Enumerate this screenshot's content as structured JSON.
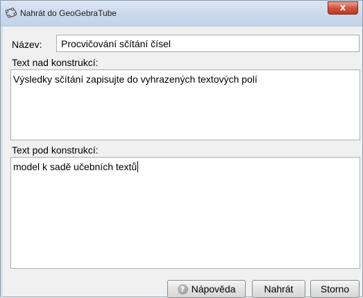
{
  "window": {
    "title": "Nahrát do GeoGebraTube",
    "close_symbol": "x"
  },
  "form": {
    "name_label": "Název:",
    "name_value": "Procvičování sčítání čísel",
    "text_above_label": "Text nad konstrukcí:",
    "text_above_value": "Výsledky sčítání zapisujte do vyhrazených textových polí",
    "text_below_label": "Text pod konstrukcí:",
    "text_below_value": "model k sadě učebních textů"
  },
  "buttons": {
    "help_label": "Nápověda",
    "help_icon_glyph": "?",
    "upload_label": "Nahrát",
    "cancel_label": "Storno"
  },
  "icons": {
    "title_icon": "geogebra-ellipse-icon",
    "help_icon": "help-circle-icon"
  },
  "colors": {
    "close_button": "#c2381c",
    "title_bar": "#c9d8ec",
    "dialog_background": "#f0f0f0"
  }
}
